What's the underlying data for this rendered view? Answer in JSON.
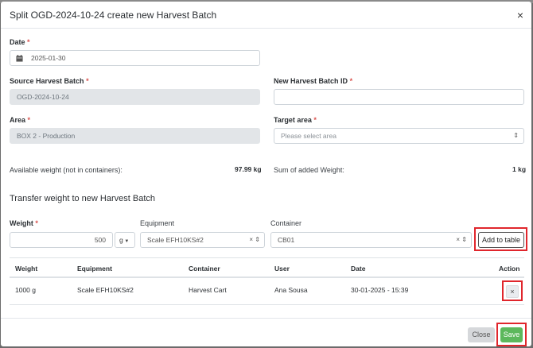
{
  "modal": {
    "title": "Split OGD-2024-10-24 create new Harvest Batch",
    "close_glyph": "×"
  },
  "form": {
    "date_label": "Date",
    "date_value": "2025-01-30",
    "source_label": "Source Harvest Batch",
    "source_value": "OGD-2024-10-24",
    "new_id_label": "New Harvest Batch ID",
    "new_id_value": "",
    "area_label": "Area",
    "area_value": "BOX 2 - Production",
    "target_label": "Target area",
    "target_placeholder": "Please select area",
    "required_mark": "*"
  },
  "summary": {
    "available_label": "Available weight (not in containers):",
    "available_value": "97.99 kg",
    "sum_label": "Sum of added Weight:",
    "sum_value": "1 kg"
  },
  "transfer": {
    "section_title": "Transfer weight to new Harvest Batch",
    "weight_label": "Weight",
    "weight_value": "500",
    "unit_value": "g",
    "equipment_label": "Equipment",
    "equipment_value": "Scale EFH10KS#2",
    "container_label": "Container",
    "container_value": "CB01",
    "add_button": "Add to table"
  },
  "table": {
    "columns": [
      "Weight",
      "Equipment",
      "Container",
      "User",
      "Date",
      "Action"
    ],
    "rows": [
      {
        "weight": "1000 g",
        "equipment": "Scale EFH10KS#2",
        "container": "Harvest Cart",
        "user": "Ana Sousa",
        "date": "30-01-2025 - 15:39",
        "action": "×"
      }
    ]
  },
  "footer": {
    "close_button": "Close",
    "save_button": "Save"
  },
  "colors": {
    "save": "#5cb85c",
    "close": "#d6d8db",
    "highlight": "#e0262c",
    "required": "#d9534f"
  },
  "icons": {
    "calendar": "calendar-icon",
    "close": "close-icon",
    "clear": "clear-icon",
    "sort": "sort-arrows-icon",
    "caret": "caret-down-icon"
  }
}
